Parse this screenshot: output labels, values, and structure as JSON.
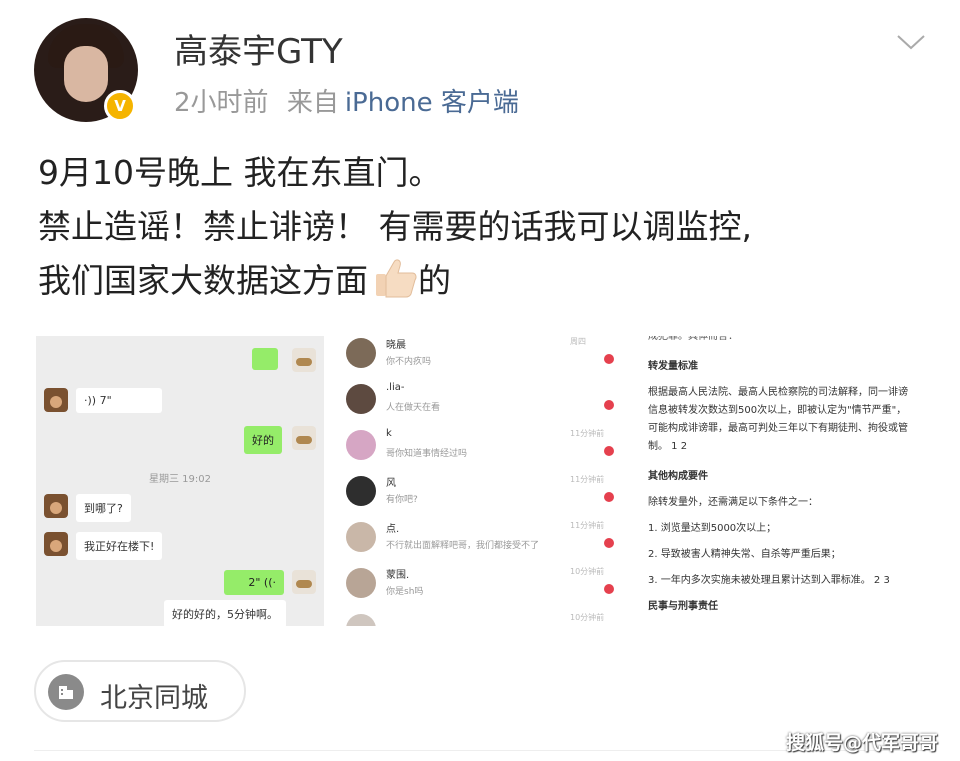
{
  "post": {
    "username": "高泰宇GTY",
    "time": "2小时前",
    "from_prefix": "来自",
    "client": "iPhone 客户端",
    "badge": "V",
    "text_lines": [
      "9月10号晚上 我在东直门。",
      "禁止造谣！禁止诽谤！ 有需要的话我可以调监控,",
      "我们国家大数据这方面"
    ],
    "text_tail": "的",
    "location": "北京同城"
  },
  "chat": {
    "voice1": "7\"",
    "reply1": "好的",
    "timestamp": "星期三 19:02",
    "q1": "到哪了?",
    "q2": "我正好在楼下!",
    "voice2": "2\"",
    "reply2": "好的好的，5分钟啊。"
  },
  "messages": [
    {
      "name": "晓晨",
      "sub": "你不内疚吗",
      "time": "周四"
    },
    {
      "name": ".lia-",
      "sub": "人在做天在看",
      "time": ""
    },
    {
      "name": "k",
      "sub": "哥你知道事情经过吗",
      "time": "11分钟前"
    },
    {
      "name": "风",
      "sub": "有你吧?",
      "time": "11分钟前"
    },
    {
      "name": "点.",
      "sub": "不行就出面解释吧哥，我们都接受不了",
      "time": "11分钟前"
    },
    {
      "name": "蒙围.",
      "sub": "你是sh吗",
      "time": "10分钟前"
    },
    {
      "name": "",
      "sub": "",
      "time": "10分钟前"
    }
  ],
  "doc": {
    "top_cut": "成犯罪。具体而言：",
    "h1": "转发量标准",
    "p1": "根据最高人民法院、最高人民检察院的司法解释，同一诽谤信息被转发次数达到500次以上，即被认定为\"情节严重\"，可能构成诽谤罪，最高可判处三年以下有期徒刑、拘役或管制。 1 2",
    "h2": "其他构成要件",
    "p2": "除转发量外，还需满足以下条件之一：",
    "items": [
      "1. 浏览量达到5000次以上；",
      "2. 导致被害人精神失常、自杀等严重后果；",
      "3. 一年内多次实施未被处理且累计达到入罪标准。 2 3"
    ],
    "h3": "民事与刑事责任"
  },
  "watermark": "搜狐号@代军哥哥",
  "icons": [
    "chevron-down-icon",
    "thumbs-up-icon",
    "building-icon",
    "voice-icon"
  ]
}
